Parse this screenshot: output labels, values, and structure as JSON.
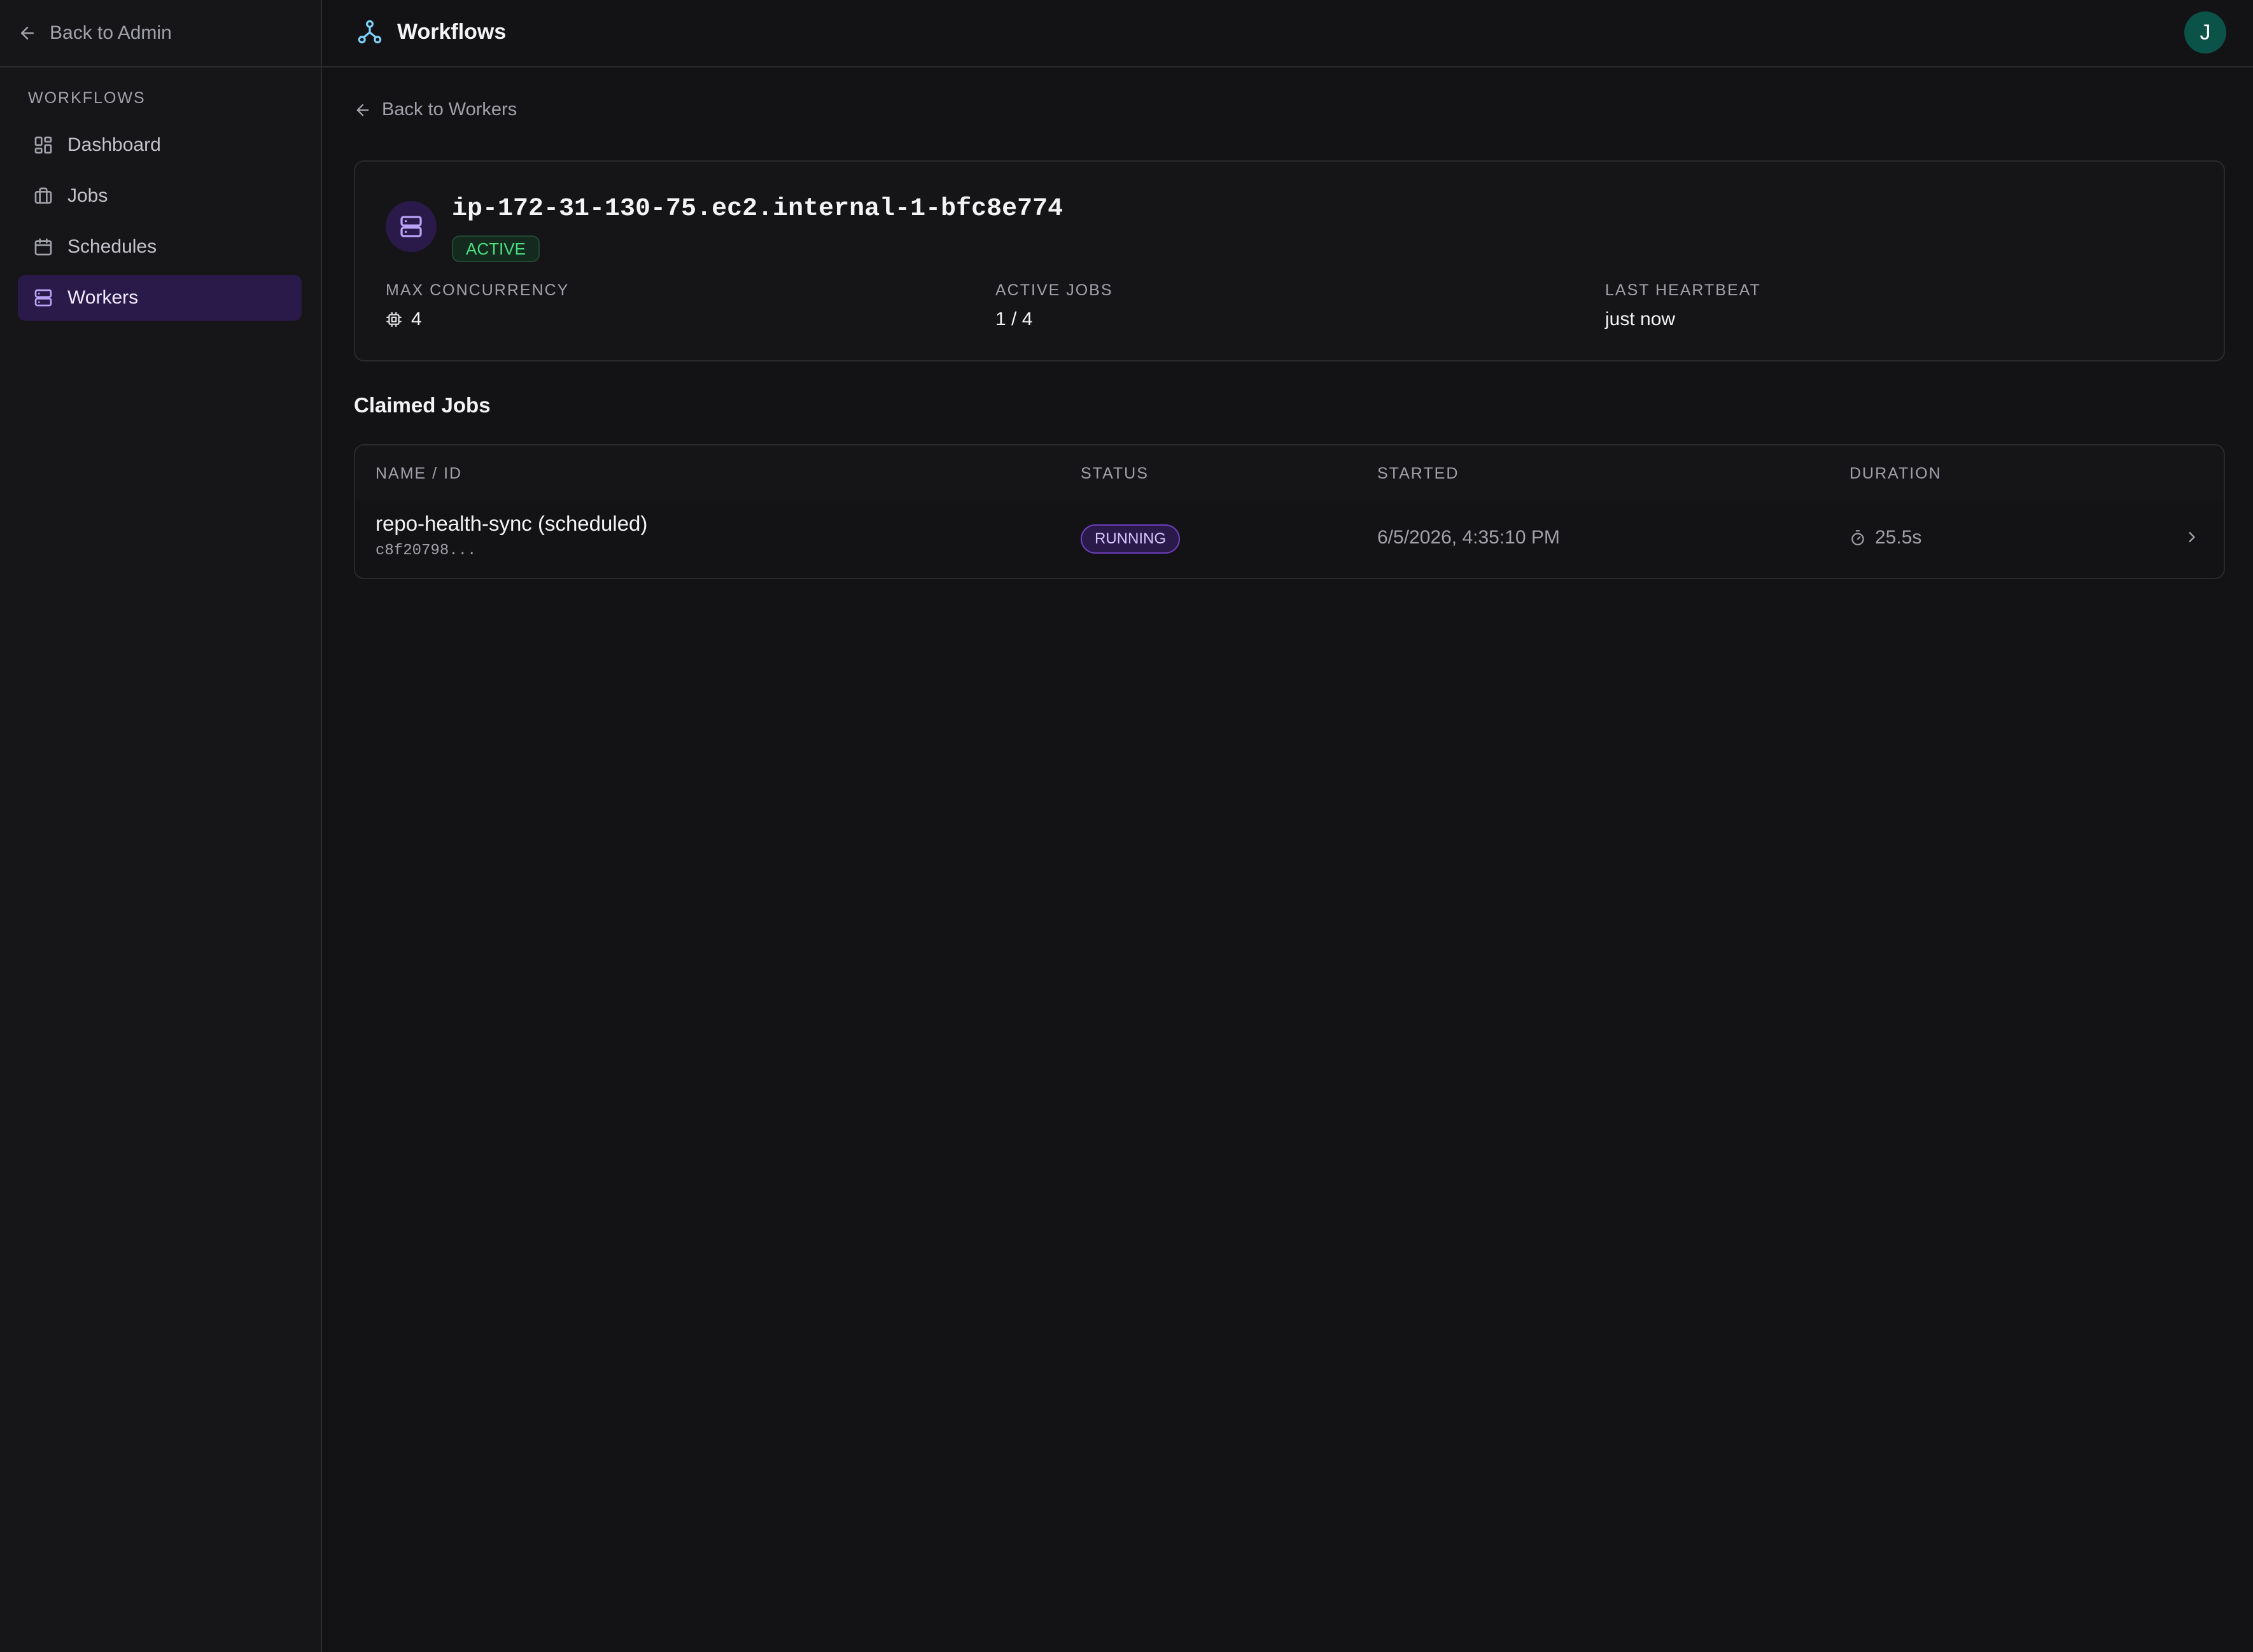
{
  "sidebar": {
    "back_label": "Back to Admin",
    "section_label": "WORKFLOWS",
    "items": [
      {
        "label": "Dashboard",
        "icon": "dashboard-icon",
        "active": false
      },
      {
        "label": "Jobs",
        "icon": "briefcase-icon",
        "active": false
      },
      {
        "label": "Schedules",
        "icon": "calendar-icon",
        "active": false
      },
      {
        "label": "Workers",
        "icon": "server-icon",
        "active": true
      }
    ]
  },
  "header": {
    "title": "Workflows",
    "icon": "workflow-icon",
    "avatar_initial": "J",
    "avatar_color": "#0b5248"
  },
  "main": {
    "back_label": "Back to Workers",
    "worker": {
      "name": "ip-172-31-130-75.ec2.internal-1-bfc8e774",
      "status": "ACTIVE",
      "status_color": "#4ade80",
      "icon": "server-icon",
      "stats": [
        {
          "label": "MAX CONCURRENCY",
          "value": "4",
          "icon": "cpu-icon"
        },
        {
          "label": "ACTIVE JOBS",
          "value": "1 / 4"
        },
        {
          "label": "LAST HEARTBEAT",
          "value": "just now"
        }
      ]
    },
    "claimed_jobs_title": "Claimed Jobs",
    "table": {
      "columns": [
        "NAME / ID",
        "STATUS",
        "STARTED",
        "DURATION"
      ],
      "rows": [
        {
          "name": "repo-health-sync (scheduled)",
          "id": "c8f20798...",
          "status": "RUNNING",
          "status_color": "#d8c4ff",
          "started": "6/5/2026, 4:35:10 PM",
          "duration": "25.5s",
          "duration_icon": "timer-icon"
        }
      ]
    }
  },
  "colors": {
    "background": "#131315",
    "accent": "#2a1a4a"
  }
}
